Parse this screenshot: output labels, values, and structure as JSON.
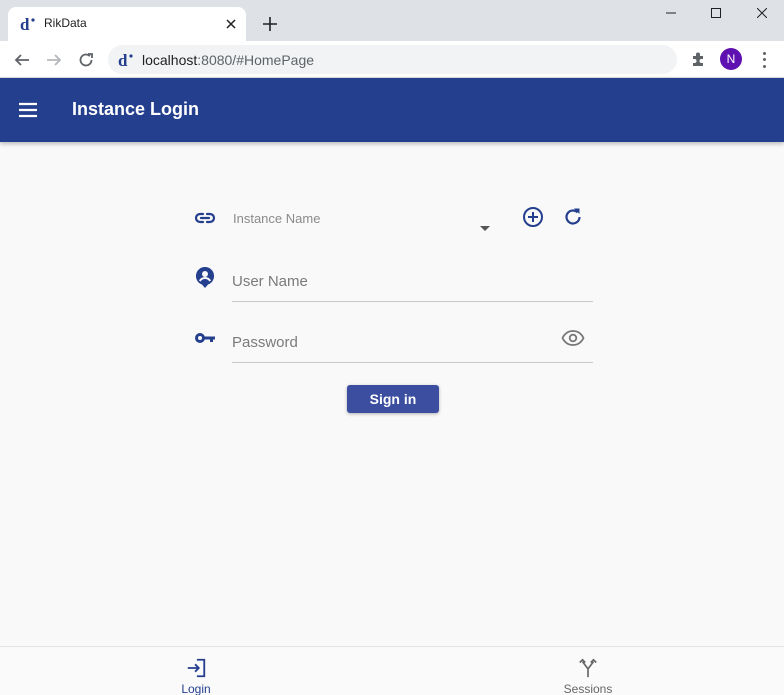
{
  "browser": {
    "tab_title": "RikData",
    "url_host": "localhost",
    "url_path": ":8080/#HomePage",
    "profile_initial": "N"
  },
  "appbar": {
    "title": "Instance Login"
  },
  "form": {
    "instance_placeholder": "Instance Name",
    "username_placeholder": "User Name",
    "password_placeholder": "Password",
    "signin_label": "Sign in"
  },
  "bottom_nav": {
    "items": [
      {
        "label": "Login",
        "icon": "login-icon",
        "active": true
      },
      {
        "label": "Sessions",
        "icon": "sessions-icon",
        "active": false
      }
    ]
  },
  "colors": {
    "primary": "#253f8f",
    "button": "#3b4ea0",
    "icon": "#253f8f",
    "profile": "#5e10b1"
  }
}
